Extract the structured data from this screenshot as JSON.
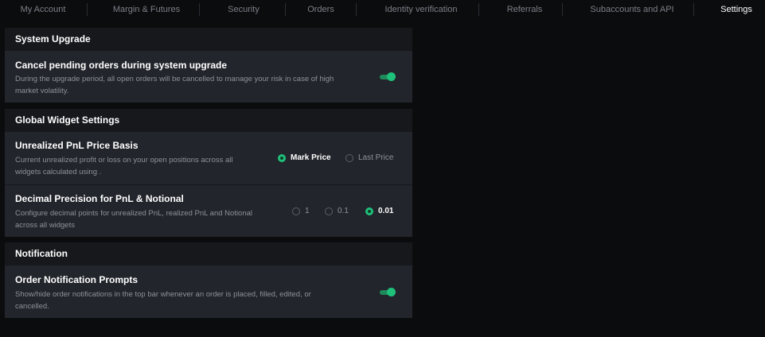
{
  "tabs": [
    {
      "label": "My Account",
      "active": false
    },
    {
      "label": "Margin & Futures",
      "active": false
    },
    {
      "label": "Security",
      "active": false
    },
    {
      "label": "Orders",
      "active": false
    },
    {
      "label": "Identity verification",
      "active": false
    },
    {
      "label": "Referrals",
      "active": false
    },
    {
      "label": "Subaccounts and API",
      "active": false
    },
    {
      "label": "Settings",
      "active": true
    }
  ],
  "system_upgrade": {
    "title": "System Upgrade",
    "cancel_orders": {
      "title": "Cancel pending orders during system upgrade",
      "desc_line1": "During the upgrade period, all open orders will be cancelled to manage your risk in case of high",
      "desc_line2": "market volatility.",
      "enabled": true
    }
  },
  "global_widget": {
    "title": "Global Widget Settings",
    "pnl_basis": {
      "title": "Unrealized PnL Price Basis",
      "desc_line1": "Current unrealized profit or loss on your open positions across all",
      "desc_line2": "widgets calculated using .",
      "options": [
        "Mark Price",
        "Last Price"
      ],
      "selected": "Mark Price"
    },
    "decimal_precision": {
      "title": "Decimal Precision for PnL & Notional",
      "desc_line1": "Configure decimal points for unrealized PnL, realized PnL and Notional",
      "desc_line2": "across all widgets",
      "options": [
        "1",
        "0.1",
        "0.01"
      ],
      "selected": "0.01"
    }
  },
  "notification": {
    "title": "Notification",
    "order_prompts": {
      "title": "Order Notification Prompts",
      "desc_line1": "Show/hide order notifications in the top bar whenever an order is placed, filled, edited, or",
      "desc_line2": "cancelled.",
      "enabled": true
    }
  },
  "colors": {
    "accent": "#1ec07a",
    "background": "#0b0c0e",
    "panel": "#16181c",
    "row": "#22252b"
  }
}
